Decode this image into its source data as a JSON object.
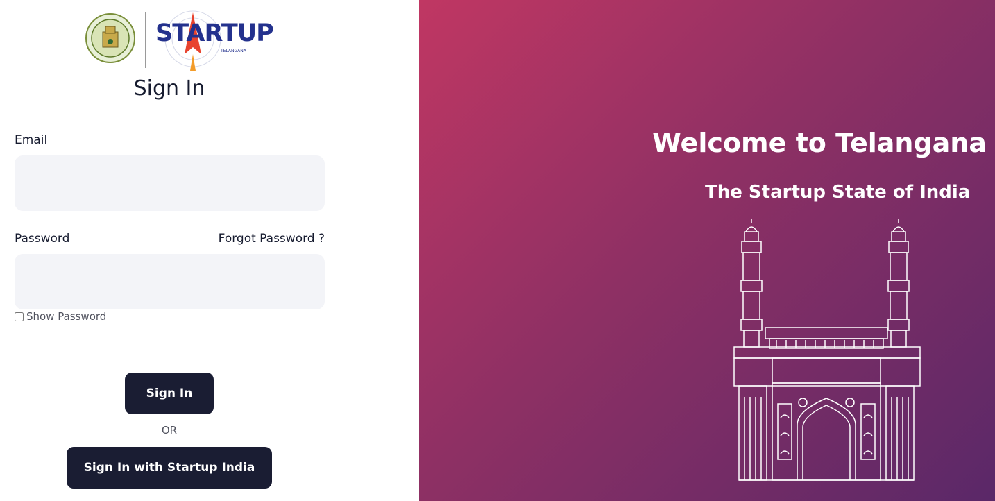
{
  "signin": {
    "title": "Sign In",
    "email_label": "Email",
    "email_value": "",
    "password_label": "Password",
    "password_value": "",
    "forgot_password": "Forgot Password ?",
    "show_password": "Show Password",
    "signin_button": "Sign In",
    "or_text": "OR",
    "startup_india_button": "Sign In with Startup India"
  },
  "logos": {
    "startup_logo": "STARTUP",
    "startup_sub": "TELANGANA"
  },
  "hero": {
    "welcome": "Welcome to Telangana",
    "tagline": "The Startup State of India"
  },
  "colors": {
    "button_bg": "#1a1d33",
    "input_bg": "#f3f4f8",
    "gradient_start": "#c03763",
    "gradient_end": "#5a2868",
    "logo_blue": "#23318d"
  }
}
